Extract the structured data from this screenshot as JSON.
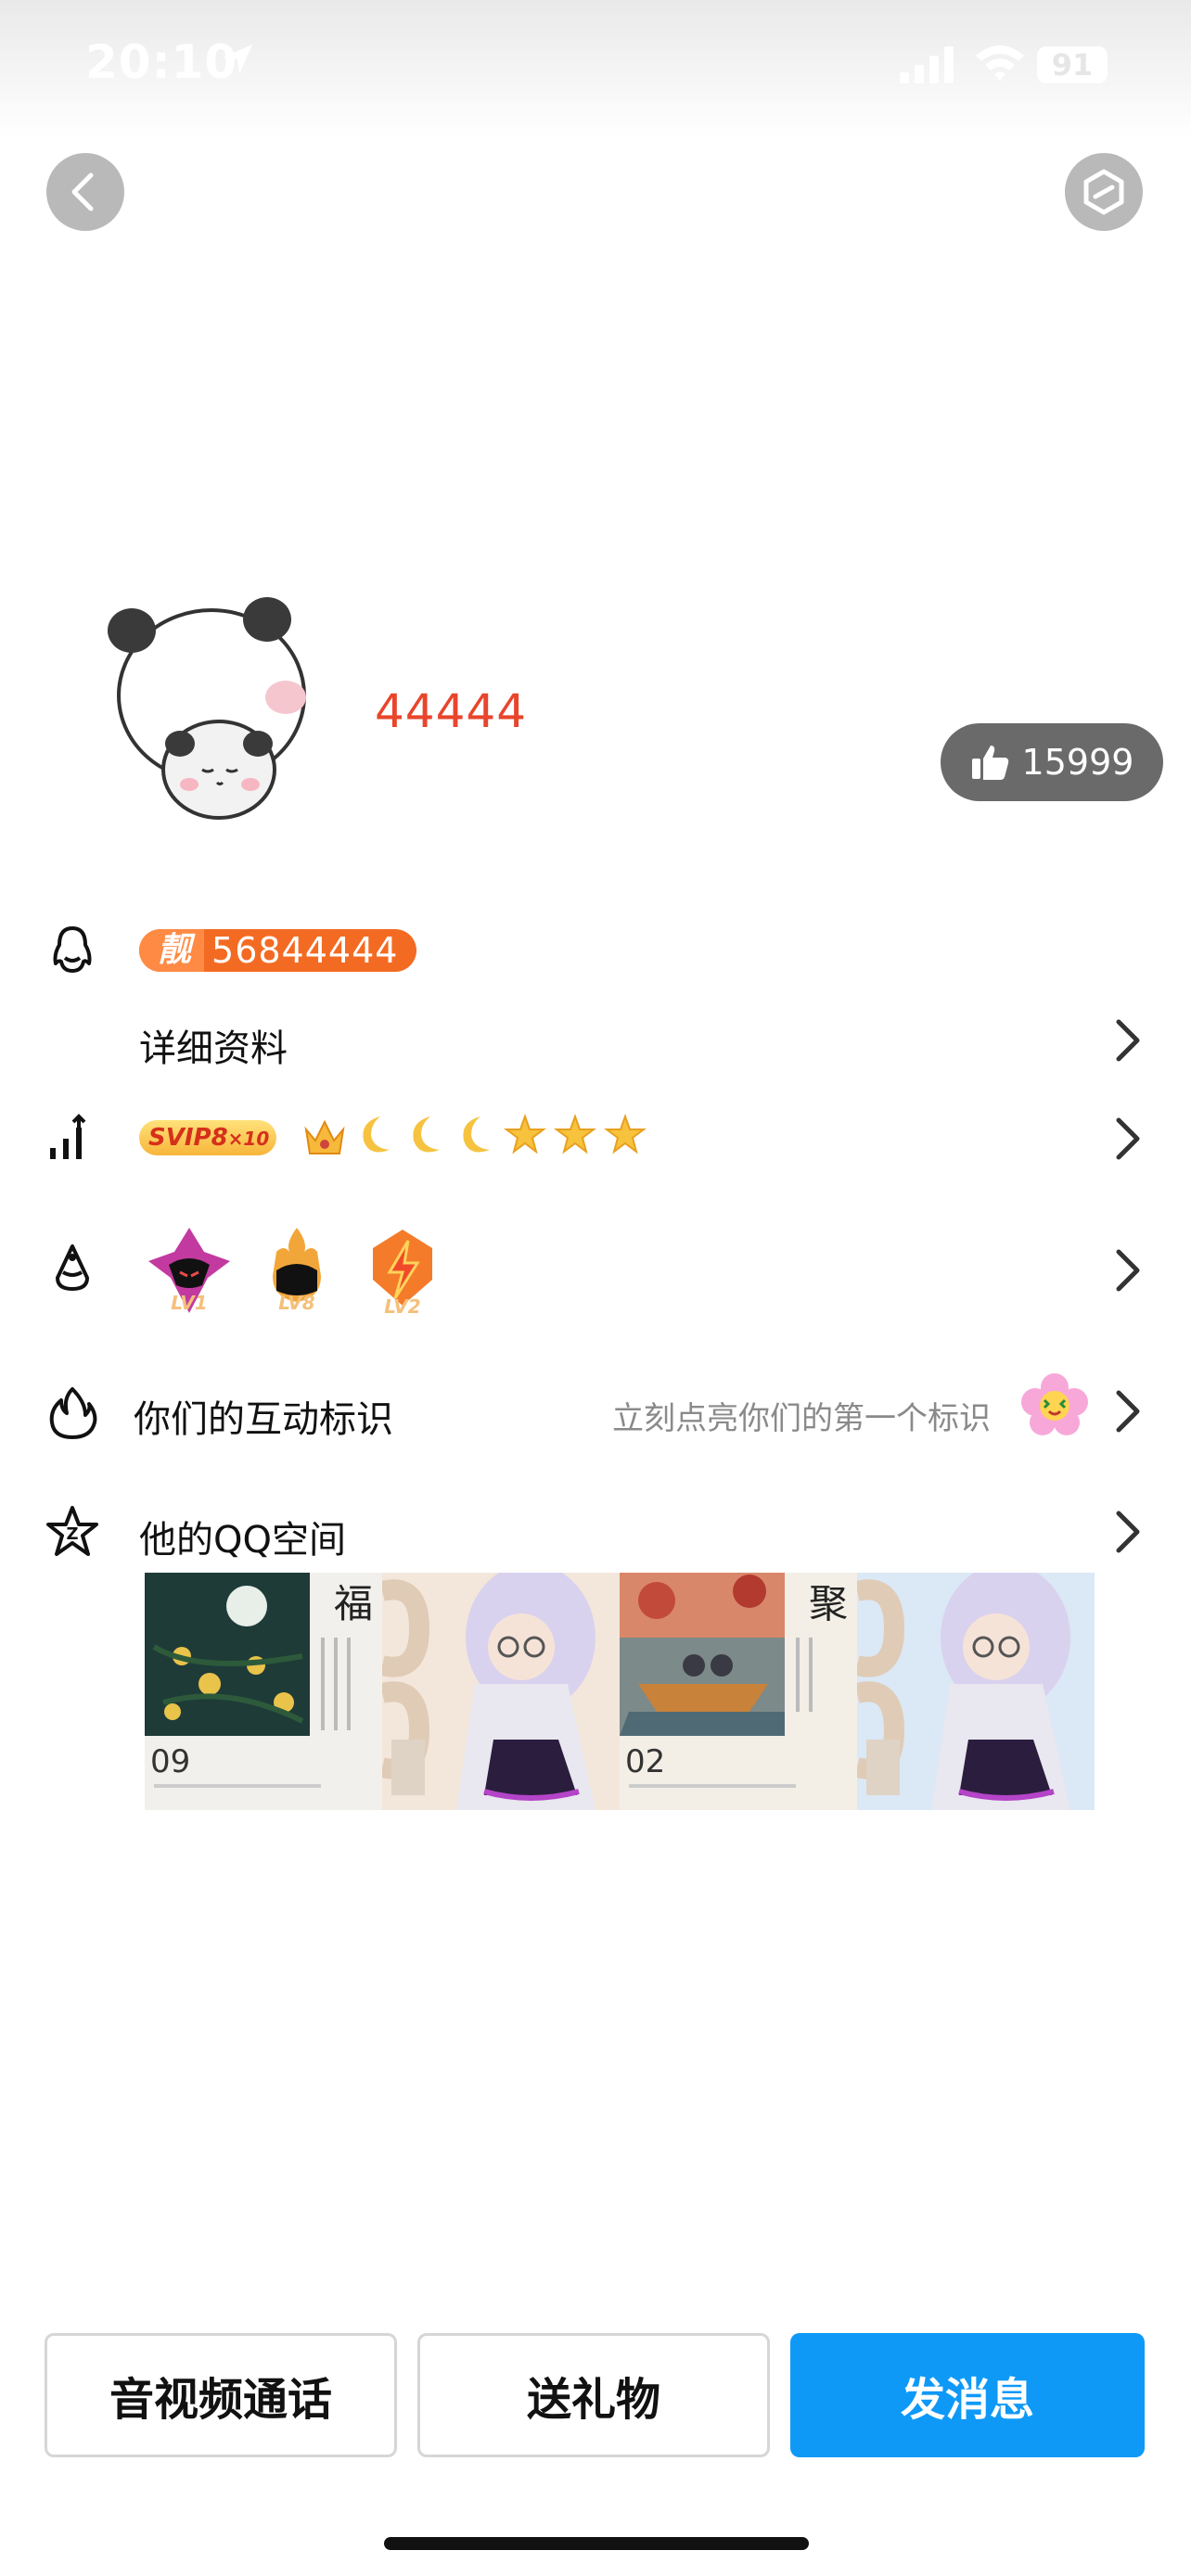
{
  "status_bar": {
    "time": "20:10",
    "battery": "91"
  },
  "profile": {
    "nickname": "44444",
    "likes": "15999"
  },
  "qq_number": {
    "badge": "靓",
    "number": "56844444"
  },
  "rows": {
    "details_label": "详细资料",
    "interaction_label": "你们的互动标识",
    "interaction_hint": "立刻点亮你们的第一个标识",
    "qzone_label": "他的QQ空间"
  },
  "vip": {
    "svip_label": "SVIP8",
    "svip_multiplier": "×10",
    "level_icons": [
      "crown-icon",
      "moon-icon",
      "moon-icon",
      "moon-icon",
      "star-icon",
      "star-icon",
      "star-icon"
    ]
  },
  "medals": [
    {
      "label": "LV1",
      "color": "#c23aa0"
    },
    {
      "label": "LV8",
      "color": "#f2a63a"
    },
    {
      "label": "LV2",
      "color": "#f47b2a"
    }
  ],
  "qzone_photos": [
    {
      "date": "09",
      "char": "福"
    },
    {
      "date": "",
      "char": ""
    },
    {
      "date": "02",
      "char": "聚"
    },
    {
      "date": "",
      "char": ""
    }
  ],
  "actions": {
    "call": "音视频通话",
    "gift": "送礼物",
    "message": "发消息"
  },
  "colors": {
    "accent_blue": "#0e99f7",
    "nickname_red": "#e8452c",
    "badge_orange": "#f36b22"
  }
}
